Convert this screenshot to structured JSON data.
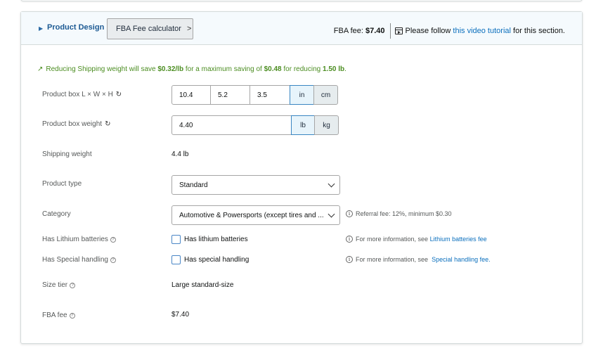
{
  "header": {
    "section_title": "Product Design",
    "calculator_button": "FBA Fee calculator",
    "fba_fee_label": "FBA fee:",
    "fba_fee_value": "$7.40",
    "follow_text": "Please follow",
    "video_link": "this video tutorial",
    "follow_suffix": "for this section."
  },
  "banner": {
    "prefix": "Reducing Shipping weight will save",
    "save_rate": "$0.32/lb",
    "mid": "for a maximum saving of",
    "max_saving": "$0.48",
    "mid2": "for reducing",
    "reduce_amount": "1.50 lb",
    "suffix": ".",
    "color": "#4b8d21"
  },
  "form": {
    "dimensions": {
      "label": "Product box L × W × H",
      "length": "10.4",
      "width": "5.2",
      "height": "3.5",
      "unit_in": "in",
      "unit_cm": "cm",
      "selected_unit": "in"
    },
    "weight": {
      "label": "Product box weight",
      "value": "4.40",
      "unit_lb": "lb",
      "unit_kg": "kg",
      "selected_unit": "lb"
    },
    "shipping_weight": {
      "label": "Shipping weight",
      "value": "4.4 lb"
    },
    "product_type": {
      "label": "Product type",
      "selected": "Standard"
    },
    "category": {
      "label": "Category",
      "selected": "Automotive & Powersports (except tires and ...",
      "note": "Referral fee: 12%, minimum $0.30"
    },
    "lithium": {
      "label": "Has Lithium batteries",
      "checkbox_label": "Has lithium batteries",
      "checked": false,
      "note_prefix": "For more information, see",
      "note_link": "Lithium batteries fee"
    },
    "special_handling": {
      "label": "Has Special handling",
      "checkbox_label": "Has special handling",
      "checked": false,
      "note_prefix": "For more information, see",
      "note_link": "Special handling fee."
    },
    "size_tier": {
      "label": "Size tier",
      "value": "Large standard-size"
    },
    "fba_fee": {
      "label": "FBA fee",
      "value": "$7.40"
    }
  },
  "icons": {
    "expand": "caret-right-icon",
    "chevron": "chevron-right-icon",
    "video": "video-icon",
    "trend": "trend-up-icon",
    "refresh": "refresh-icon",
    "help": "help-icon",
    "info": "info-icon",
    "dropdown": "chevron-down-icon"
  }
}
